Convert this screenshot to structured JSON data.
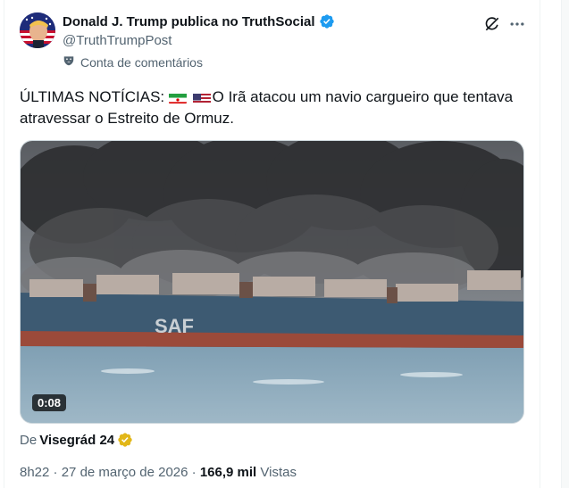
{
  "tweet": {
    "display_name": "Donald J. Trump publica no TruthSocial",
    "handle": "@TruthTrumpPost",
    "account_context": "Conta de comentários",
    "text_prefix": "ÚLTIMAS NOTÍCIAS:",
    "text_flags": [
      "flag-iran-icon",
      "flag-usa-icon"
    ],
    "text_body": "O Irã atacou um navio cargueiro que tentava atravessar o Estreito de Ormuz.",
    "media": {
      "duration": "0:08",
      "hull_text": "SAF"
    },
    "source": {
      "prefix": "De",
      "name": "Visegrád 24"
    },
    "meta": {
      "time": "8h22",
      "separator": " · ",
      "date": "27 de março de 2026",
      "views_count": "166,9 mil",
      "views_label": " Vistas"
    }
  },
  "colors": {
    "verified_blue": "#1d9bf0",
    "verified_gold": "#e2b719",
    "secondary_text": "#536471"
  }
}
